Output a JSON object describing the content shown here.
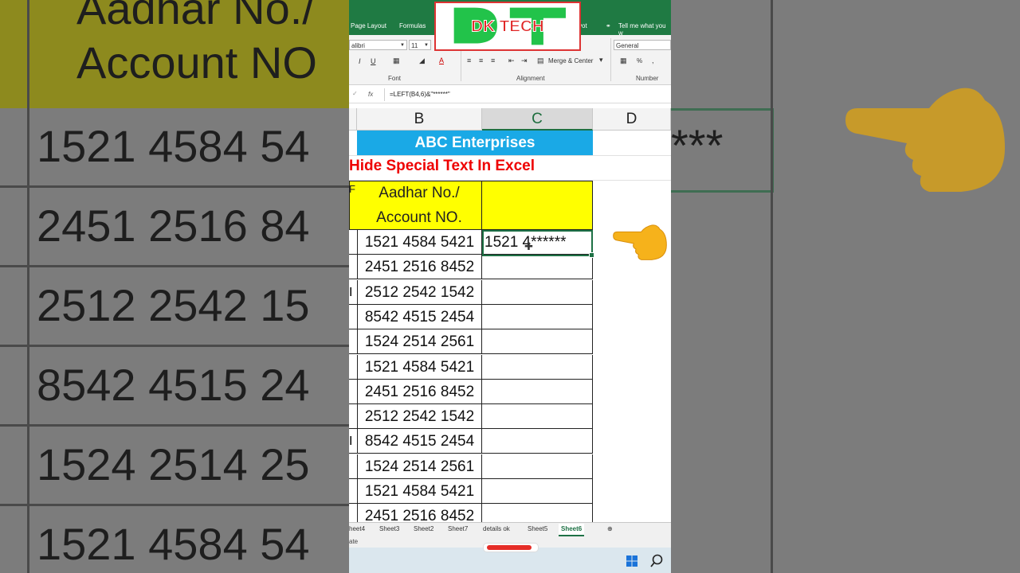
{
  "ribbon": {
    "tabs": [
      "Page Layout",
      "Formulas",
      "vot",
      "Tell me what you w"
    ],
    "font_name": "alibri",
    "font_size": "11",
    "merge_center": "Merge & Center",
    "number_format": "General",
    "percent": "%",
    "groups": [
      "Font",
      "Alignment",
      "Number"
    ]
  },
  "logo": {
    "text": "DK TECH",
    "colors": {
      "green": "#22c34a",
      "red": "#e02424"
    }
  },
  "formula_bar": {
    "fx": "fx",
    "formula": "=LEFT(B4,6)&\"******\""
  },
  "columns": [
    "B",
    "C",
    "D"
  ],
  "sheet": {
    "company": "ABC Enterprises",
    "subtitle": "Hide Special Text In Excel",
    "header_b": [
      "Aadhar No./",
      "Account NO."
    ],
    "header_a_fragment": "F",
    "c4": "1521 4******",
    "rows": [
      {
        "a": "",
        "b": "1521 4584 5421"
      },
      {
        "a": "",
        "b": "2451 2516 8452"
      },
      {
        "a": "I",
        "b": "2512 2542 1542"
      },
      {
        "a": "",
        "b": "8542 4515 2454"
      },
      {
        "a": "",
        "b": "1524 2514 2561"
      },
      {
        "a": "",
        "b": "1521 4584 5421"
      },
      {
        "a": "",
        "b": "2451 2516 8452"
      },
      {
        "a": "",
        "b": "2512 2542 1542"
      },
      {
        "a": "I",
        "b": "8542 4515 2454"
      },
      {
        "a": "",
        "b": "1524 2514 2561"
      },
      {
        "a": "",
        "b": "1521 4584 5421"
      },
      {
        "a": "",
        "b": "2451 2516 8452"
      }
    ]
  },
  "sheet_tabs": [
    "heet4",
    "Sheet3",
    "Sheet2",
    "Sheet7",
    "details ok",
    "Sheet5",
    "Sheet6"
  ],
  "active_sheet": "Sheet6",
  "status_text": "ate",
  "background": {
    "left_title_a": "Aadhar No./",
    "left_title_b": "Account NO",
    "left_rows": [
      "1521 4584 54",
      "2451 2516 84",
      "2512 2542 15",
      "8542 4515 24",
      "1524 2514 25",
      "1521 4584 54"
    ],
    "left_row_a": [
      "",
      "",
      "I",
      "1",
      "",
      ""
    ],
    "right_stars": "***"
  }
}
